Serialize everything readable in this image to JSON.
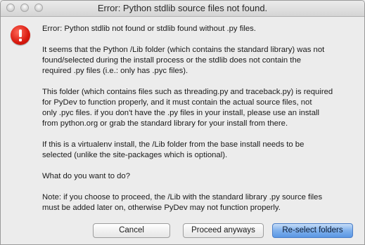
{
  "window": {
    "title": "Error: Python stdlib source files not found."
  },
  "icons": {
    "alert": "exclamation-stop-icon"
  },
  "message": {
    "paragraphs": [
      "Error: Python stdlib not found or stdlib found without .py files.",
      "It seems that the Python /Lib folder (which contains the standard library) was not\nfound/selected during the install process or the stdlib does not contain the\nrequired .py files (i.e.: only has .pyc files).",
      "This folder (which contains files such as threading.py and traceback.py) is required\nfor PyDev to function properly, and it must contain the actual source files, not\nonly .pyc files. if you don't have the .py files in your install, please use an install\nfrom python.org or grab the standard library for your install from there.",
      "If this is a virtualenv install, the /Lib folder from the base install needs to be\nselected (unlike the site-packages which is optional).",
      "What do you want to do?",
      "Note: if you choose to proceed, the /Lib with the standard library .py source files\nmust be added later on, otherwise PyDev may not function properly."
    ]
  },
  "buttons": {
    "cancel": "Cancel",
    "proceed": "Proceed anyways",
    "reselect": "Re-select folders"
  },
  "colors": {
    "alert_red": "#d8190e",
    "default_button_blue": "#7fb0ec"
  }
}
